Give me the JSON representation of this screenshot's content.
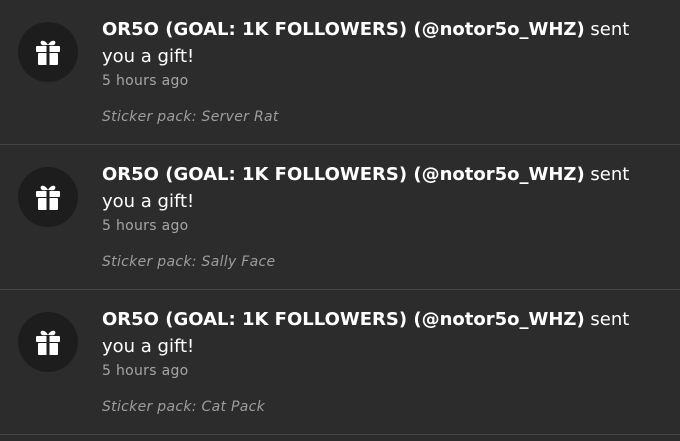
{
  "notifications": [
    {
      "icon": "gift-icon",
      "sender": "OR5O (GOAL: 1K FOLLOWERS) (@notor5o_WHZ)",
      "action": " sent you a gift!",
      "time": "5 hours ago",
      "detail": "Sticker pack: Server Rat"
    },
    {
      "icon": "gift-icon",
      "sender": "OR5O (GOAL: 1K FOLLOWERS) (@notor5o_WHZ)",
      "action": " sent you a gift!",
      "time": "5 hours ago",
      "detail": "Sticker pack: Sally Face"
    },
    {
      "icon": "gift-icon",
      "sender": "OR5O (GOAL: 1K FOLLOWERS) (@notor5o_WHZ)",
      "action": " sent you a gift!",
      "time": "5 hours ago",
      "detail": "Sticker pack: Cat Pack"
    }
  ]
}
